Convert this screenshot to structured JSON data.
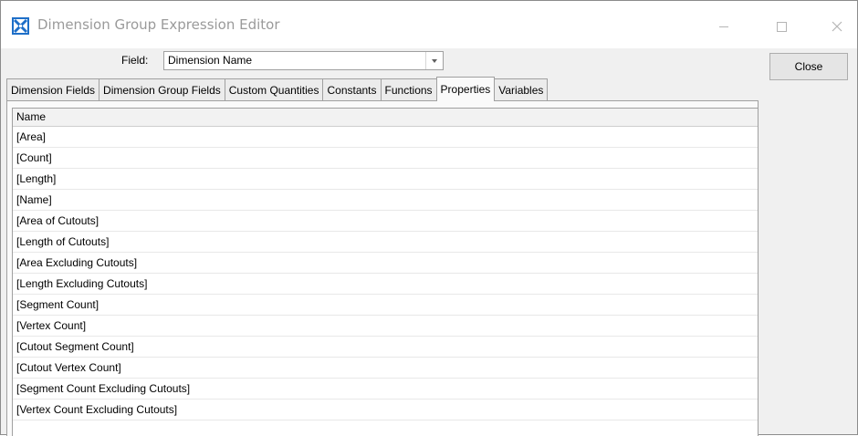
{
  "window": {
    "title": "Dimension Group Expression Editor",
    "icon": "dimension-x-icon",
    "controls": [
      "minimize-icon",
      "maximize-icon",
      "close-icon"
    ]
  },
  "field": {
    "label": "Field:",
    "value": "Dimension Name"
  },
  "close_button": {
    "label": "Close"
  },
  "tabs": [
    {
      "label": "Dimension Fields",
      "active": false
    },
    {
      "label": "Dimension Group Fields",
      "active": false
    },
    {
      "label": "Custom Quantities",
      "active": false
    },
    {
      "label": "Constants",
      "active": false
    },
    {
      "label": "Functions",
      "active": false
    },
    {
      "label": "Properties",
      "active": true
    },
    {
      "label": "Variables",
      "active": false
    }
  ],
  "list": {
    "header": "Name",
    "rows": [
      "[Area]",
      "[Count]",
      "[Length]",
      "[Name]",
      "[Area of Cutouts]",
      "[Length of Cutouts]",
      "[Area Excluding Cutouts]",
      "[Length Excluding Cutouts]",
      "[Segment Count]",
      "[Vertex Count]",
      "[Cutout Segment Count]",
      "[Cutout Vertex Count]",
      "[Segment Count Excluding Cutouts]",
      "[Vertex Count Excluding Cutouts]"
    ]
  }
}
